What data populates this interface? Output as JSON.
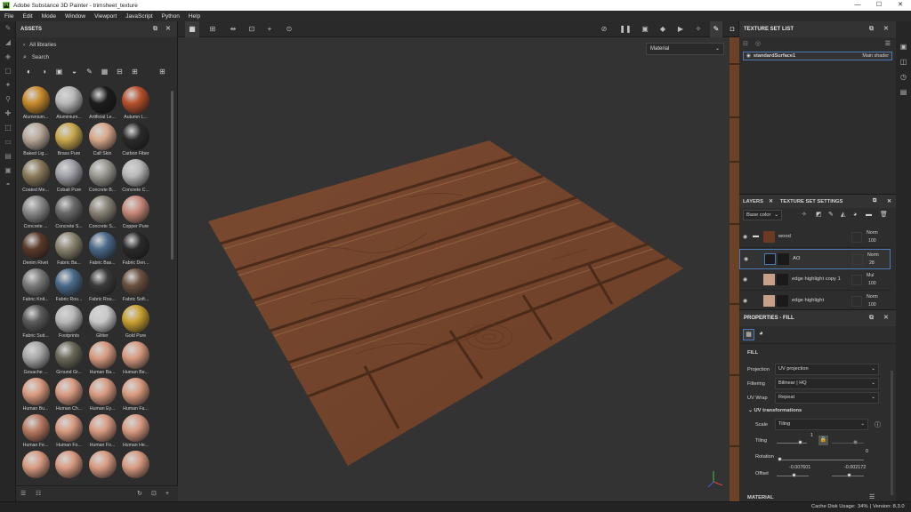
{
  "window": {
    "title": "Adobe Substance 3D Painter - trimsheet_texture"
  },
  "menu": [
    "File",
    "Edit",
    "Mode",
    "Window",
    "Viewport",
    "JavaScript",
    "Python",
    "Help"
  ],
  "assets": {
    "title": "ASSETS",
    "library": "All libraries",
    "search_placeholder": "Search",
    "items": [
      {
        "label": "Aluminium...",
        "color": "#c98a2a"
      },
      {
        "label": "Aluminium...",
        "color": "#b8b8b8"
      },
      {
        "label": "Artificial Le...",
        "color": "#1c1c1c"
      },
      {
        "label": "Autumn L...",
        "color": "#b8502a"
      },
      {
        "label": "Baked Lig...",
        "color": "#b8a898"
      },
      {
        "label": "Brass Pure",
        "color": "#c9a84c"
      },
      {
        "label": "Calf Skin",
        "color": "#d8a88a"
      },
      {
        "label": "Carbon Fiber",
        "color": "#2a2a2a"
      },
      {
        "label": "Coated Me...",
        "color": "#8a7a5a"
      },
      {
        "label": "Cobalt Pure",
        "color": "#a0a0a8"
      },
      {
        "label": "Concrete B...",
        "color": "#9a9890"
      },
      {
        "label": "Concrete C...",
        "color": "#b8b8b8"
      },
      {
        "label": "Concrete ...",
        "color": "#8a8a8a"
      },
      {
        "label": "Concrete S...",
        "color": "#6a6a6a"
      },
      {
        "label": "Concrete S...",
        "color": "#8a8478"
      },
      {
        "label": "Copper Pure",
        "color": "#c98a7a"
      },
      {
        "label": "Denim Rivet",
        "color": "#5a3a2a"
      },
      {
        "label": "Fabric Ba...",
        "color": "#8a8470"
      },
      {
        "label": "Fabric Bas...",
        "color": "#4a6a8a"
      },
      {
        "label": "Fabric Den...",
        "color": "#2a2a2a"
      },
      {
        "label": "Fabric Knit...",
        "color": "#7a7a7a"
      },
      {
        "label": "Fabric Rou...",
        "color": "#4a6a8a"
      },
      {
        "label": "Fabric Rou...",
        "color": "#3a3a3a"
      },
      {
        "label": "Fabric Soft...",
        "color": "#6a5040"
      },
      {
        "label": "Fabric Suit...",
        "color": "#5a5a5a"
      },
      {
        "label": "Footprints",
        "color": "#b8b8b8"
      },
      {
        "label": "Glitter",
        "color": "#c8c8c8"
      },
      {
        "label": "Gold Pure",
        "color": "#c9a030"
      },
      {
        "label": "Gouache ...",
        "color": "#a8a8a8"
      },
      {
        "label": "Ground Gr...",
        "color": "#6a6858"
      },
      {
        "label": "Human Ba...",
        "color": "#d89a80"
      },
      {
        "label": "Human Be...",
        "color": "#d89a80"
      },
      {
        "label": "Human Bu...",
        "color": "#d89a80"
      },
      {
        "label": "Human Ch...",
        "color": "#d89a80"
      },
      {
        "label": "Human Ey...",
        "color": "#d89a80"
      },
      {
        "label": "Human Fa...",
        "color": "#d89a80"
      },
      {
        "label": "Human Fe...",
        "color": "#b87a60"
      },
      {
        "label": "Human Fo...",
        "color": "#d89a80"
      },
      {
        "label": "Human Fo...",
        "color": "#d89a80"
      },
      {
        "label": "Human He...",
        "color": "#d89a80"
      },
      {
        "label": "",
        "color": "#d89a80"
      },
      {
        "label": "",
        "color": "#d89a80"
      },
      {
        "label": "",
        "color": "#d89a80"
      },
      {
        "label": "",
        "color": "#d89a80"
      }
    ]
  },
  "viewport": {
    "material_mode": "Material"
  },
  "texture_set_list": {
    "title": "TEXTURE SET LIST",
    "set_name": "standardSurface1",
    "shader": "Main shader"
  },
  "layers": {
    "tab_layers": "LAYERS",
    "tab_settings": "TEXTURE SET SETTINGS",
    "channel": "Base color",
    "rows": [
      {
        "name": "wood",
        "blend": "Norm",
        "opacity": "100",
        "thumb": "#6a3a22"
      },
      {
        "name": "AO",
        "blend": "Norm",
        "opacity": "28",
        "thumb": "#1a1a1a"
      },
      {
        "name": "edge highlight copy 1",
        "blend": "Mul",
        "opacity": "100",
        "thumb": "#c8a088"
      },
      {
        "name": "edge highlight",
        "blend": "Norm",
        "opacity": "100",
        "thumb": "#c8a088"
      }
    ]
  },
  "properties": {
    "title": "PROPERTIES - FILL",
    "section_fill": "FILL",
    "projection_label": "Projection",
    "projection_value": "UV projection",
    "filtering_label": "Filtering",
    "filtering_value": "Bilinear | HQ",
    "uvwrap_label": "UV Wrap",
    "uvwrap_value": "Repeat",
    "uv_transformations": "UV transformations",
    "scale_label": "Scale",
    "scale_value": "Tiling",
    "tiling_label": "Tiling",
    "tiling_value": "1",
    "rotation_label": "Rotation",
    "rotation_value": "0",
    "offset_label": "Offset",
    "offset_x": "-0.007601",
    "offset_y": "-0.002172",
    "section_material": "MATERIAL"
  },
  "status": {
    "cache_label": "Cache Disk Usage:",
    "cache_value": "34%",
    "version": "| Version: 8.3.0"
  }
}
